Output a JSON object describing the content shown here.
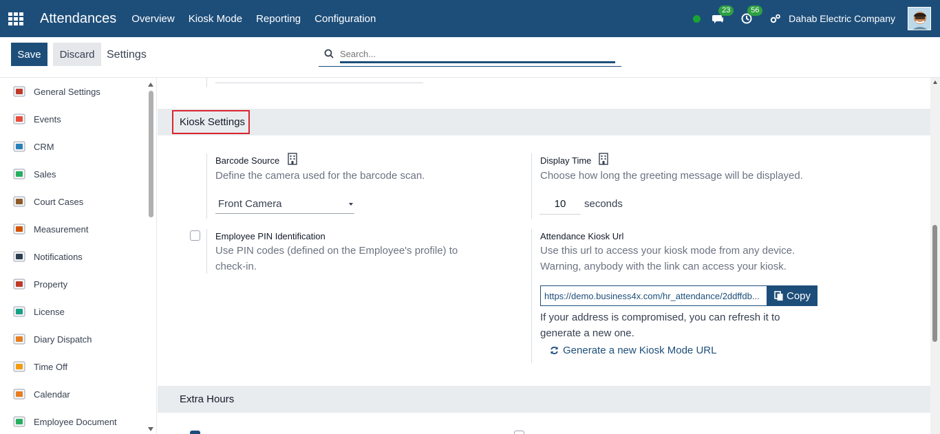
{
  "navbar": {
    "app_title": "Attendances",
    "menus": [
      "Overview",
      "Kiosk Mode",
      "Reporting",
      "Configuration"
    ],
    "chat_count": "23",
    "activity_count": "56",
    "company": "Dahab Electric Company"
  },
  "control": {
    "save_label": "Save",
    "discard_label": "Discard",
    "breadcrumb": "Settings",
    "search_placeholder": "Search..."
  },
  "sidebar": {
    "items": [
      {
        "label": "General Settings",
        "icon": "gear-icon"
      },
      {
        "label": "Events",
        "icon": "calendar-event-icon"
      },
      {
        "label": "CRM",
        "icon": "crm-icon"
      },
      {
        "label": "Sales",
        "icon": "sales-icon"
      },
      {
        "label": "Court Cases",
        "icon": "scales-icon"
      },
      {
        "label": "Measurement",
        "icon": "ruler-icon"
      },
      {
        "label": "Notifications",
        "icon": "notification-icon"
      },
      {
        "label": "Property",
        "icon": "house-icon"
      },
      {
        "label": "License",
        "icon": "license-icon"
      },
      {
        "label": "Diary Dispatch",
        "icon": "dispatch-icon"
      },
      {
        "label": "Time Off",
        "icon": "timeoff-icon"
      },
      {
        "label": "Calendar",
        "icon": "calendar-icon"
      },
      {
        "label": "Employee Document",
        "icon": "document-icon"
      }
    ]
  },
  "kiosk": {
    "section_title": "Kiosk Settings",
    "barcode": {
      "label": "Barcode Source",
      "description": "Define the camera used for the barcode scan.",
      "value": "Front Camera"
    },
    "display_time": {
      "label": "Display Time",
      "description": "Choose how long the greeting message will be displayed.",
      "value": "10",
      "unit": "seconds"
    },
    "pin": {
      "label": "Employee PIN Identification",
      "description_line1": "Use PIN codes (defined on the Employee's profile) to",
      "description_line2": "check-in."
    },
    "kiosk_url": {
      "label": "Attendance Kiosk Url",
      "description_line1": "Use this url to access your kiosk mode from any device.",
      "description_line2": "Warning, anybody with the link can access your kiosk.",
      "url": "https://demo.business4x.com/hr_attendance/2ddffdb...",
      "copy_label": "Copy",
      "note_line1": "If your address is compromised, you can refresh it to",
      "note_line2": "generate a new one.",
      "generate_label": "Generate a new Kiosk Mode URL"
    }
  },
  "extra_hours": {
    "section_title": "Extra Hours"
  },
  "colors": {
    "navbar": "#1d4e7a",
    "highlight_border": "#d9232e",
    "badge": "#2ea043",
    "presence": "#19a532"
  }
}
